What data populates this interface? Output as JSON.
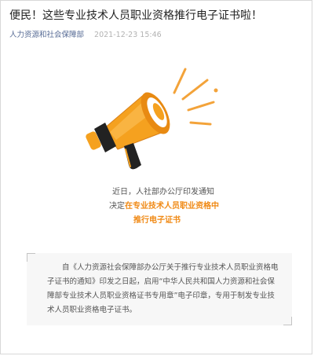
{
  "article": {
    "title": "便民！这些专业技术人员职业资格推行电子证书啦！",
    "account": "人力资源和社会保障部",
    "date": "2021-12-23 15:46"
  },
  "intro": {
    "line1": "近日，人社部办公厅印发通知",
    "line2_prefix": "决定",
    "line2_highlight": "在专业技术人员职业资格中",
    "line3_highlight": "推行电子证书"
  },
  "notice": {
    "text": "自《人力资源社会保障部办公厅关于推行专业技术人员职业资格电子证书的通知》印发之日起，启用“中华人民共和国人力资源和社会保障部专业技术人员职业资格证书专用章”电子印章，专用于制发专业技术人员职业资格电子证书。"
  },
  "colors": {
    "accent": "#f08a16",
    "account_link": "#576b95",
    "date_gray": "#b2b2b2",
    "megaphone_orange": "#f5a11f",
    "megaphone_dark": "#222222",
    "ray_orange": "#f3a33a"
  },
  "icons": {
    "illustration": "megaphone-icon"
  }
}
